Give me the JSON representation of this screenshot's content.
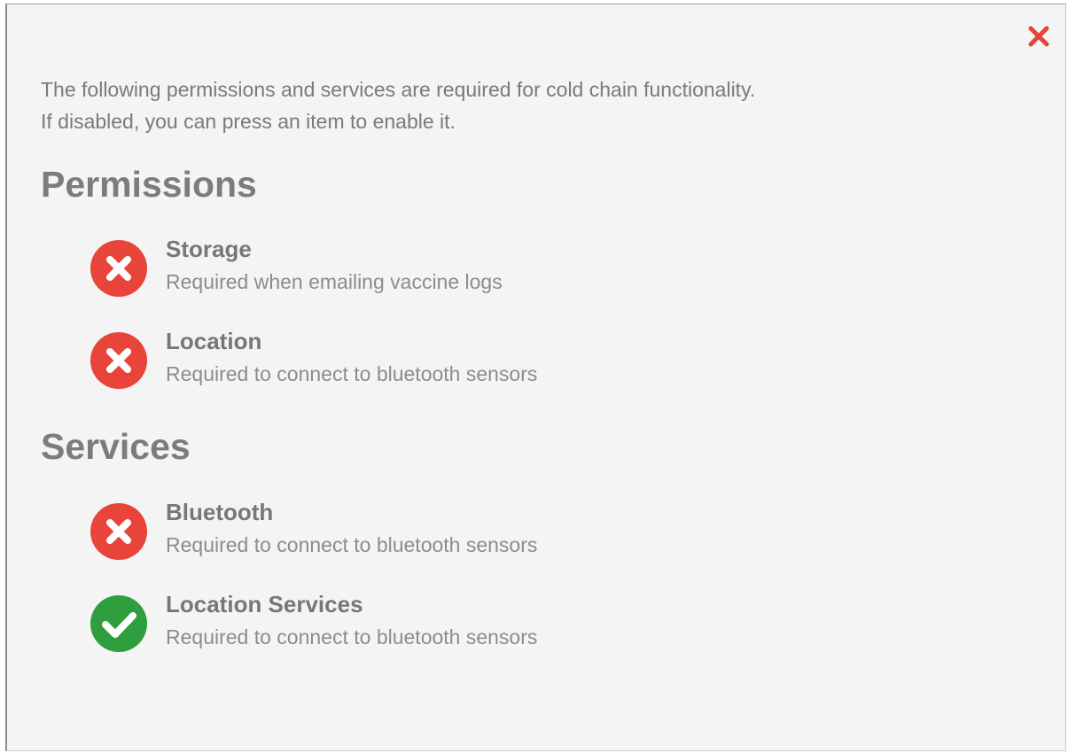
{
  "intro": {
    "line1": "The following permissions and services are required for cold chain functionality.",
    "line2": "If disabled, you can press an item to enable it."
  },
  "permissions": {
    "title": "Permissions",
    "items": [
      {
        "name": "Storage",
        "description": "Required when emailing vaccine logs",
        "status": "disabled",
        "icon": "x-circle-icon"
      },
      {
        "name": "Location",
        "description": "Required to connect to bluetooth sensors",
        "status": "disabled",
        "icon": "x-circle-icon"
      }
    ]
  },
  "services": {
    "title": "Services",
    "items": [
      {
        "name": "Bluetooth",
        "description": "Required to connect to bluetooth sensors",
        "status": "disabled",
        "icon": "x-circle-icon"
      },
      {
        "name": "Location Services",
        "description": "Required to connect to bluetooth sensors",
        "status": "enabled",
        "icon": "check-circle-icon"
      }
    ]
  },
  "colors": {
    "disabled": "#e8443a",
    "enabled": "#2e9e3e",
    "close": "#e8443a",
    "text": "#7a7a7a"
  }
}
